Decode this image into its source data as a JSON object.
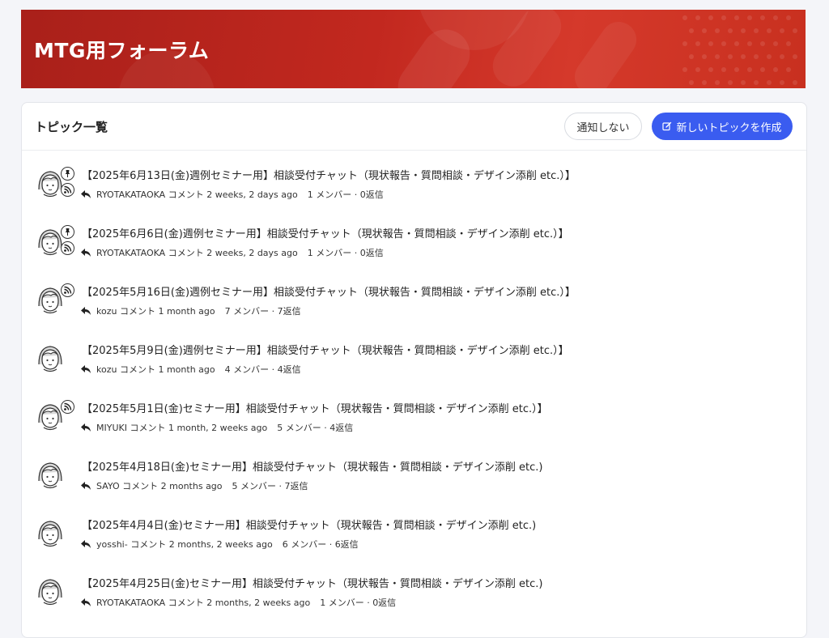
{
  "banner": {
    "title": "MTG用フォーラム"
  },
  "header": {
    "title": "トピック一覧",
    "mute_label": "通知しない",
    "new_topic_label": "新しいトピックを作成"
  },
  "topics": [
    {
      "title": "【2025年6月13日(金)週例セミナー用】相談受付チャット（現状報告・質問相談・デザイン添削 etc.）】",
      "author": "RYOTAKATAOKA",
      "action": "コメント",
      "time": "2 weeks, 2 days ago",
      "stats": "1 メンバー · 0返信",
      "pinned": true,
      "subscribed": true
    },
    {
      "title": "【2025年6月6日(金)週例セミナー用】相談受付チャット（現状報告・質問相談・デザイン添削 etc.）】",
      "author": "RYOTAKATAOKA",
      "action": "コメント",
      "time": "2 weeks, 2 days ago",
      "stats": "1 メンバー · 0返信",
      "pinned": true,
      "subscribed": true
    },
    {
      "title": "【2025年5月16日(金)週例セミナー用】相談受付チャット（現状報告・質問相談・デザイン添削 etc.）】",
      "author": "kozu",
      "action": "コメント",
      "time": "1 month ago",
      "stats": "7 メンバー · 7返信",
      "pinned": false,
      "subscribed": true
    },
    {
      "title": "【2025年5月9日(金)週例セミナー用】相談受付チャット（現状報告・質問相談・デザイン添削 etc.）】",
      "author": "kozu",
      "action": "コメント",
      "time": "1 month ago",
      "stats": "4 メンバー · 4返信",
      "pinned": false,
      "subscribed": false
    },
    {
      "title": "【2025年5月1日(金)セミナー用】相談受付チャット（現状報告・質問相談・デザイン添削 etc.）】",
      "author": "MIYUKI",
      "action": "コメント",
      "time": "1 month, 2 weeks ago",
      "stats": "5 メンバー · 4返信",
      "pinned": false,
      "subscribed": true
    },
    {
      "title": "【2025年4月18日(金)セミナー用】相談受付チャット（現状報告・質問相談・デザイン添削 etc.)",
      "author": "SAYO",
      "action": "コメント",
      "time": "2 months ago",
      "stats": "5 メンバー · 7返信",
      "pinned": false,
      "subscribed": false
    },
    {
      "title": "【2025年4月4日(金)セミナー用】相談受付チャット（現状報告・質問相談・デザイン添削 etc.)",
      "author": "yosshi-",
      "action": "コメント",
      "time": "2 months, 2 weeks ago",
      "stats": "6 メンバー · 6返信",
      "pinned": false,
      "subscribed": false
    },
    {
      "title": "【2025年4月25日(金)セミナー用】相談受付チャット（現状報告・質問相談・デザイン添削 etc.)",
      "author": "RYOTAKATAOKA",
      "action": "コメント",
      "time": "2 months, 2 weeks ago",
      "stats": "1 メンバー · 0返信",
      "pinned": false,
      "subscribed": false
    }
  ],
  "colors": {
    "banner": "#c2281f",
    "primary_button": "#3a5cf0"
  },
  "icons": {
    "pin": "pin-icon",
    "subscribe": "rss-icon",
    "reply": "reply-icon",
    "compose": "edit-icon",
    "avatar": "avatar-icon"
  }
}
